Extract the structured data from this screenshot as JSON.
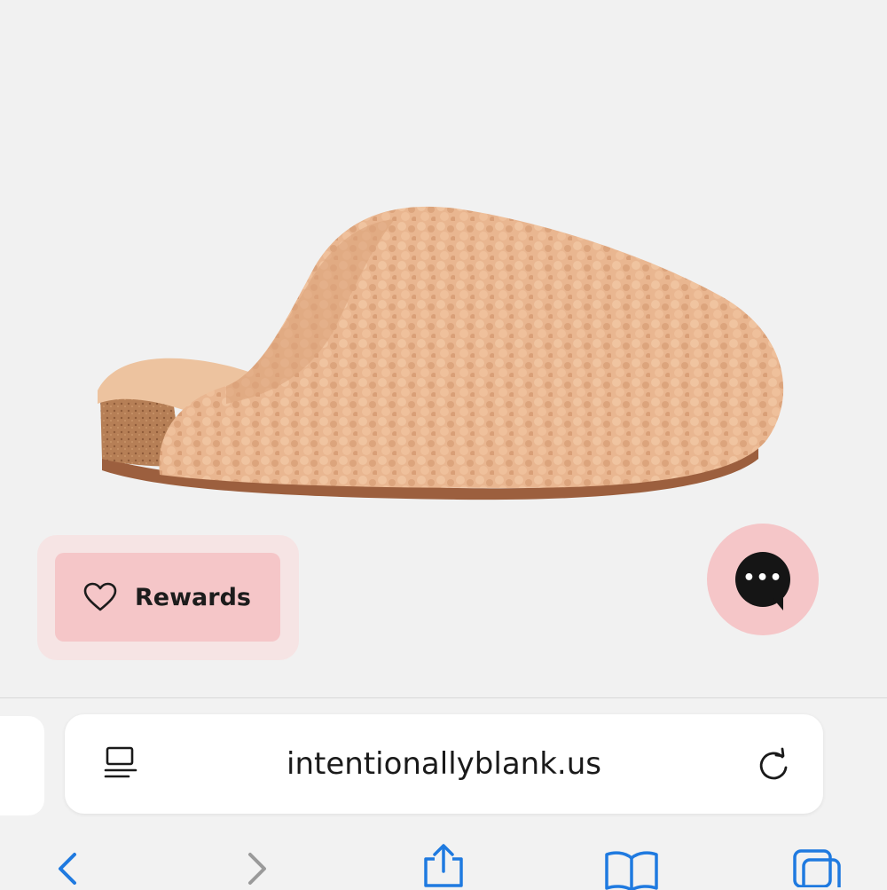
{
  "product": {
    "image_description": "tan sherpa fleece clog slipper with cork footbed",
    "fleece_color": "#e8b48f",
    "cork_color": "#b07a52",
    "sole_color": "#9c5f3e"
  },
  "rewards": {
    "label": "Rewards",
    "icon": "heart-icon",
    "color": "#f5c6c8"
  },
  "chat": {
    "icon": "chat-bubble-icon",
    "dots": "•••",
    "color": "#f5c6c8"
  },
  "browser": {
    "url": "intentionallyblank.us",
    "reader_icon": "reader-mode-icon",
    "reload_icon": "reload-icon",
    "toolbar": {
      "back_icon": "back-icon",
      "forward_icon": "forward-icon",
      "share_icon": "share-icon",
      "bookmarks_icon": "bookmarks-icon",
      "tabs_icon": "tabs-icon",
      "active_color": "#1f7ae0",
      "inactive_color": "#9a9a9a"
    }
  }
}
